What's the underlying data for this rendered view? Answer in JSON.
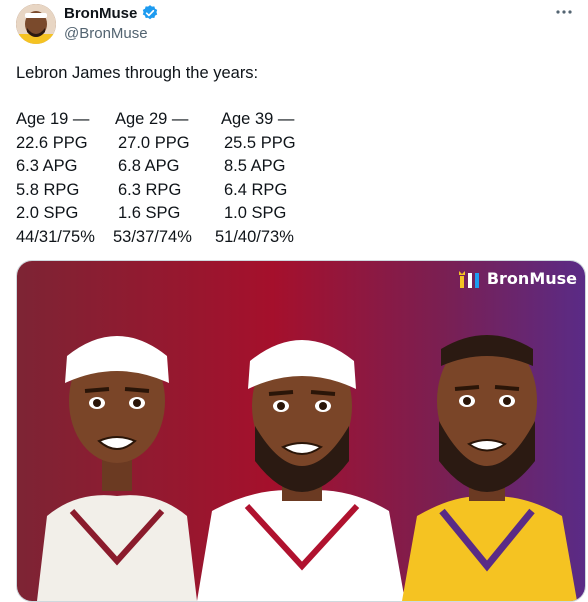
{
  "author": {
    "display_name": "BronMuse",
    "handle": "@BronMuse",
    "verified": true
  },
  "menu_icon": "more-horizontal-icon",
  "tweet": {
    "text": "Lebron James through the years:",
    "columns": [
      {
        "header": "Age 19 —",
        "lines": [
          "22.6 PPG",
          "6.3 APG",
          "5.8 RPG",
          "2.0 SPG",
          "44/31/75%"
        ]
      },
      {
        "header": "Age 29 —",
        "lines": [
          "27.0 PPG",
          "6.8 APG",
          "6.3 RPG",
          "1.6 SPG",
          "53/37/74%"
        ]
      },
      {
        "header": "Age 39 —",
        "lines": [
          "25.5 PPG",
          "8.5 APG",
          "6.4 RPG",
          "1.0 SPG",
          "51/40/73%"
        ]
      }
    ]
  },
  "media": {
    "watermark": "BronMuse",
    "colors": {
      "left": "#8a1b2c",
      "middle": "#b0122f",
      "right": "#5a2b86",
      "jersey_lakers": "#f5c322",
      "headband": "#ffffff"
    }
  },
  "colors": {
    "verified": "#1d9bf0",
    "secondary_text": "#536471",
    "primary_text": "#0f1419"
  }
}
